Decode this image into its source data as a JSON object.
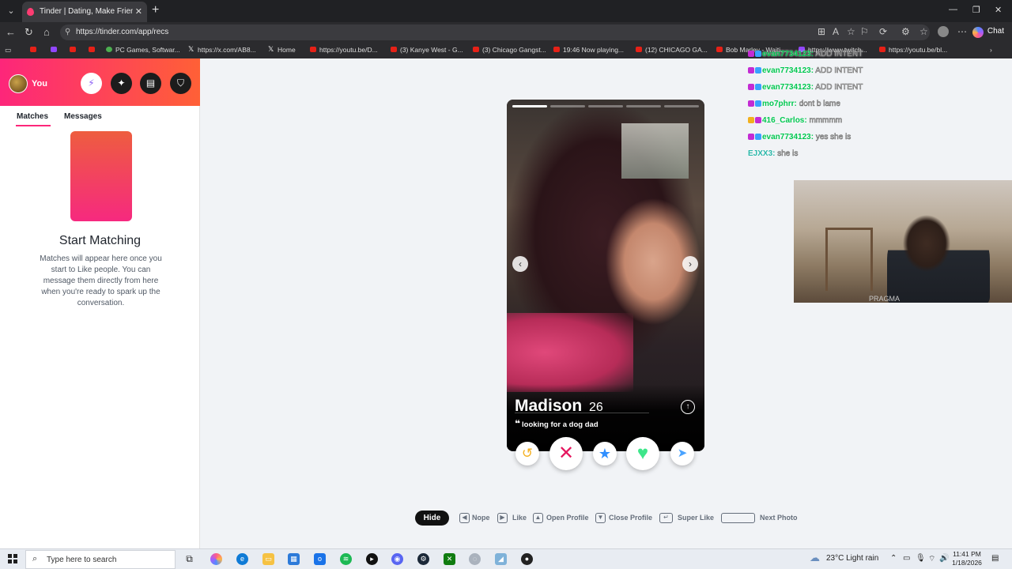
{
  "browser": {
    "tab_title": "Tinder | Dating, Make Friends & M",
    "url": "https://tinder.com/app/recs",
    "chat_label": "Chat",
    "bookmarks": [
      {
        "label": "",
        "kind": "yt"
      },
      {
        "label": "",
        "kind": "tw"
      },
      {
        "label": "",
        "kind": "yt"
      },
      {
        "label": "",
        "kind": "yt"
      },
      {
        "label": "PC Games, Softwar...",
        "kind": "game"
      },
      {
        "label": "https://x.com/AB8...",
        "kind": "x"
      },
      {
        "label": "Home",
        "kind": "x"
      },
      {
        "label": "https://youtu.be/D...",
        "kind": "yt"
      },
      {
        "label": "(3) Kanye West - G...",
        "kind": "yt"
      },
      {
        "label": "(3) Chicago Gangst...",
        "kind": "yt"
      },
      {
        "label": "19:46 Now playing...",
        "kind": "yt"
      },
      {
        "label": "(12) CHICAGO GA...",
        "kind": "yt"
      },
      {
        "label": "Bob Marley - Waiti...",
        "kind": "yt"
      },
      {
        "label": "https://www.twitch...",
        "kind": "tw"
      },
      {
        "label": "https://youtu.be/bl...",
        "kind": "yt"
      }
    ]
  },
  "sidebar": {
    "user_label": "You",
    "tabs": [
      "Matches",
      "Messages"
    ],
    "title": "Start Matching",
    "description": "Matches will appear here once you start to Like people. You can message them directly from here when you're ready to spark up the conversation."
  },
  "card": {
    "name": "Madison",
    "age": "26",
    "bio": "looking for a dog dad",
    "photo_count": 5,
    "active_photo": 0
  },
  "chat": [
    {
      "badges": [
        "#c32bd3",
        "#3aa0ff"
      ],
      "user": "evan7734123:",
      "message": "ADD INTENT"
    },
    {
      "badges": [
        "#c32bd3",
        "#3aa0ff"
      ],
      "user": "evan7734123:",
      "message": "ADD INTENT"
    },
    {
      "badges": [
        "#c32bd3",
        "#3aa0ff"
      ],
      "user": "evan7734123:",
      "message": "ADD INTENT"
    },
    {
      "badges": [
        "#c32bd3",
        "#3aa0ff"
      ],
      "user": "mo7phrr:",
      "message": "dont b lame"
    },
    {
      "badges": [
        "#f2b01e",
        "#c32bd3"
      ],
      "user": "416_Carlos:",
      "message": "mmmmm"
    },
    {
      "badges": [
        "#c32bd3",
        "#3aa0ff"
      ],
      "user": "evan7734123:",
      "message": "yes she is"
    },
    {
      "badges": [],
      "user": "EJXX3:",
      "message": "she is"
    }
  ],
  "webcam": {
    "brand_text": "PRAGMA"
  },
  "shortcuts": {
    "hide": "Hide",
    "items": [
      {
        "key": "◀",
        "label": "Nope"
      },
      {
        "key": "▶",
        "label": "Like"
      },
      {
        "key": "▲",
        "label": "Open Profile"
      },
      {
        "key": "▼",
        "label": "Close Profile"
      },
      {
        "key": "↵",
        "label": "Super Like"
      },
      {
        "key": "",
        "label": "Next Photo"
      }
    ]
  },
  "taskbar": {
    "search_placeholder": "Type here to search",
    "weather": "23°C  Light rain",
    "time": "11:41 PM",
    "date": "1/18/2026"
  },
  "colors": {
    "brand": "#fd267a",
    "brand2": "#ff6036",
    "nope": "#e5175f",
    "like": "#3ee68a",
    "super": "#2f8fff",
    "rewind": "#f4b021",
    "boost": "#4aa3ff"
  }
}
